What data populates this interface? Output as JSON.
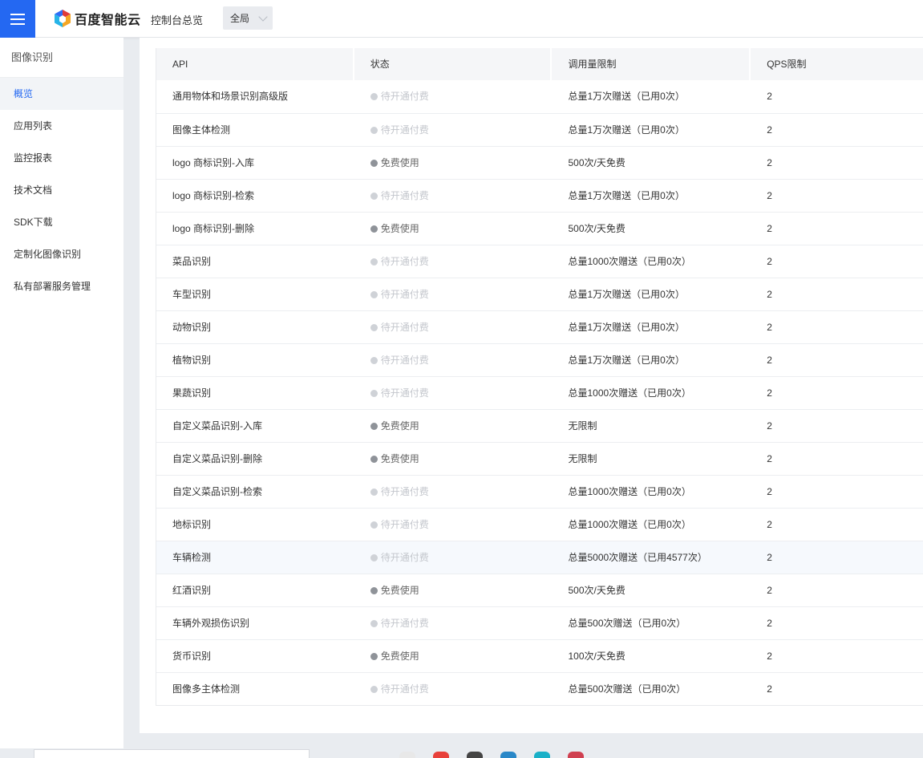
{
  "topbar": {
    "brand": "百度智能云",
    "console_link": "控制台总览",
    "region": "全局"
  },
  "sidebar": {
    "title": "图像识别",
    "items": [
      {
        "label": "概览",
        "active": true
      },
      {
        "label": "应用列表",
        "active": false
      },
      {
        "label": "监控报表",
        "active": false
      },
      {
        "label": "技术文档",
        "active": false
      },
      {
        "label": "SDK下载",
        "active": false
      },
      {
        "label": "定制化图像识别",
        "active": false
      },
      {
        "label": "私有部署服务管理",
        "active": false
      }
    ]
  },
  "table": {
    "headers": [
      "API",
      "状态",
      "调用量限制",
      "QPS限制"
    ],
    "rows": [
      {
        "api": "通用物体和场景识别高级版",
        "status": "待开通付费",
        "status_type": "pending",
        "limit": "总量1万次赠送（已用0次）",
        "qps": "2"
      },
      {
        "api": "图像主体检测",
        "status": "待开通付费",
        "status_type": "pending",
        "limit": "总量1万次赠送（已用0次）",
        "qps": "2"
      },
      {
        "api": "logo 商标识别-入库",
        "status": "免费使用",
        "status_type": "free",
        "limit": "500次/天免费",
        "qps": "2"
      },
      {
        "api": "logo 商标识别-检索",
        "status": "待开通付费",
        "status_type": "pending",
        "limit": "总量1万次赠送（已用0次）",
        "qps": "2"
      },
      {
        "api": "logo 商标识别-删除",
        "status": "免费使用",
        "status_type": "free",
        "limit": "500次/天免费",
        "qps": "2"
      },
      {
        "api": "菜品识别",
        "status": "待开通付费",
        "status_type": "pending",
        "limit": "总量1000次赠送（已用0次）",
        "qps": "2"
      },
      {
        "api": "车型识别",
        "status": "待开通付费",
        "status_type": "pending",
        "limit": "总量1万次赠送（已用0次）",
        "qps": "2"
      },
      {
        "api": "动物识别",
        "status": "待开通付费",
        "status_type": "pending",
        "limit": "总量1万次赠送（已用0次）",
        "qps": "2"
      },
      {
        "api": "植物识别",
        "status": "待开通付费",
        "status_type": "pending",
        "limit": "总量1万次赠送（已用0次）",
        "qps": "2"
      },
      {
        "api": "果蔬识别",
        "status": "待开通付费",
        "status_type": "pending",
        "limit": "总量1000次赠送（已用0次）",
        "qps": "2"
      },
      {
        "api": "自定义菜品识别-入库",
        "status": "免费使用",
        "status_type": "free",
        "limit": "无限制",
        "qps": "2"
      },
      {
        "api": "自定义菜品识别-删除",
        "status": "免费使用",
        "status_type": "free",
        "limit": "无限制",
        "qps": "2"
      },
      {
        "api": "自定义菜品识别-检索",
        "status": "待开通付费",
        "status_type": "pending",
        "limit": "总量1000次赠送（已用0次）",
        "qps": "2"
      },
      {
        "api": "地标识别",
        "status": "待开通付费",
        "status_type": "pending",
        "limit": "总量1000次赠送（已用0次）",
        "qps": "2"
      },
      {
        "api": "车辆检测",
        "status": "待开通付费",
        "status_type": "pending",
        "limit": "总量5000次赠送（已用4577次）",
        "qps": "2",
        "highlight": true
      },
      {
        "api": "红酒识别",
        "status": "免费使用",
        "status_type": "free",
        "limit": "500次/天免费",
        "qps": "2"
      },
      {
        "api": "车辆外观损伤识别",
        "status": "待开通付费",
        "status_type": "pending",
        "limit": "总量500次赠送（已用0次）",
        "qps": "2"
      },
      {
        "api": "货币识别",
        "status": "免费使用",
        "status_type": "free",
        "limit": "100次/天免费",
        "qps": "2"
      },
      {
        "api": "图像多主体检测",
        "status": "待开通付费",
        "status_type": "pending",
        "limit": "总量500次赠送（已用0次）",
        "qps": "2"
      }
    ]
  },
  "colors": {
    "brand_blue": "#2468f2",
    "pending_gray": "#c3c6cc",
    "free_gray": "#8f9399"
  }
}
